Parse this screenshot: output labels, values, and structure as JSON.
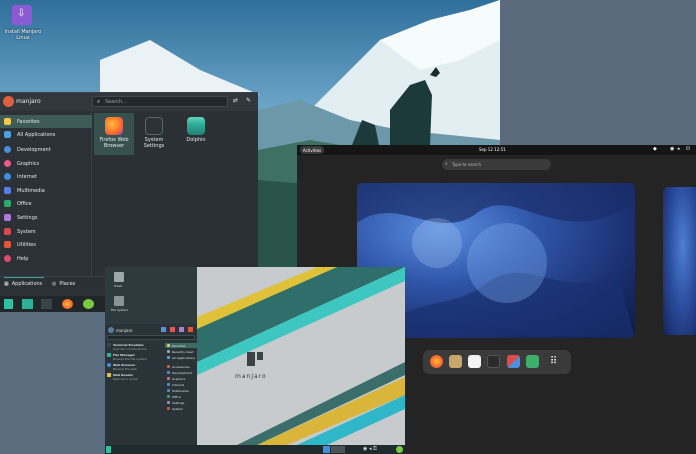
{
  "desktop": {
    "installer_label": "Install Manjaro Linux"
  },
  "kde": {
    "user": "manjaro",
    "search_placeholder": "Search...",
    "categories": [
      {
        "label": "Favorites",
        "icon": "star-icon",
        "color": "#f0c84a"
      },
      {
        "label": "All Applications",
        "icon": "grid-icon",
        "color": "#4aa3e0"
      },
      {
        "label": "Development",
        "icon": "development-icon",
        "color": "#4a8fd9"
      },
      {
        "label": "Graphics",
        "icon": "graphics-icon",
        "color": "#e85a8a"
      },
      {
        "label": "Internet",
        "icon": "internet-icon",
        "color": "#3f8fe0"
      },
      {
        "label": "Multimedia",
        "icon": "multimedia-icon",
        "color": "#5a7ee0"
      },
      {
        "label": "Office",
        "icon": "office-icon",
        "color": "#2fa86e"
      },
      {
        "label": "Settings",
        "icon": "settings-icon",
        "color": "#b07ad8"
      },
      {
        "label": "System",
        "icon": "system-icon",
        "color": "#d94a4a"
      },
      {
        "label": "Utilities",
        "icon": "utilities-icon",
        "color": "#e0583a"
      },
      {
        "label": "Help",
        "icon": "help-icon",
        "color": "#e04a6a"
      }
    ],
    "apps": [
      {
        "label": "Firefox Web Browser",
        "icon": "firefox-icon"
      },
      {
        "label": "System Settings",
        "icon": "settings-icon"
      },
      {
        "label": "Dolphin",
        "icon": "folder-icon"
      }
    ],
    "tabs": {
      "applications": "Applications",
      "places": "Places"
    }
  },
  "gnome": {
    "activities": "Activities",
    "clock": "Sep 12 12:51",
    "search_placeholder": "Type to search"
  },
  "xfce": {
    "desktop_icons": [
      "Trash",
      "File System"
    ],
    "user": "manjaro",
    "brand": "manjaro",
    "apps": [
      {
        "title": "Terminal Emulator",
        "sub": "Use the command line"
      },
      {
        "title": "File Manager",
        "sub": "Browse the file system"
      },
      {
        "title": "Web Browser",
        "sub": "Browse the web"
      },
      {
        "title": "Mail Reader",
        "sub": "Read your email"
      }
    ],
    "categories": [
      "Favorites",
      "Recently Used",
      "All Applications",
      "Accessories",
      "Development",
      "Graphics",
      "Internet",
      "Multimedia",
      "Office",
      "Settings",
      "System"
    ]
  }
}
